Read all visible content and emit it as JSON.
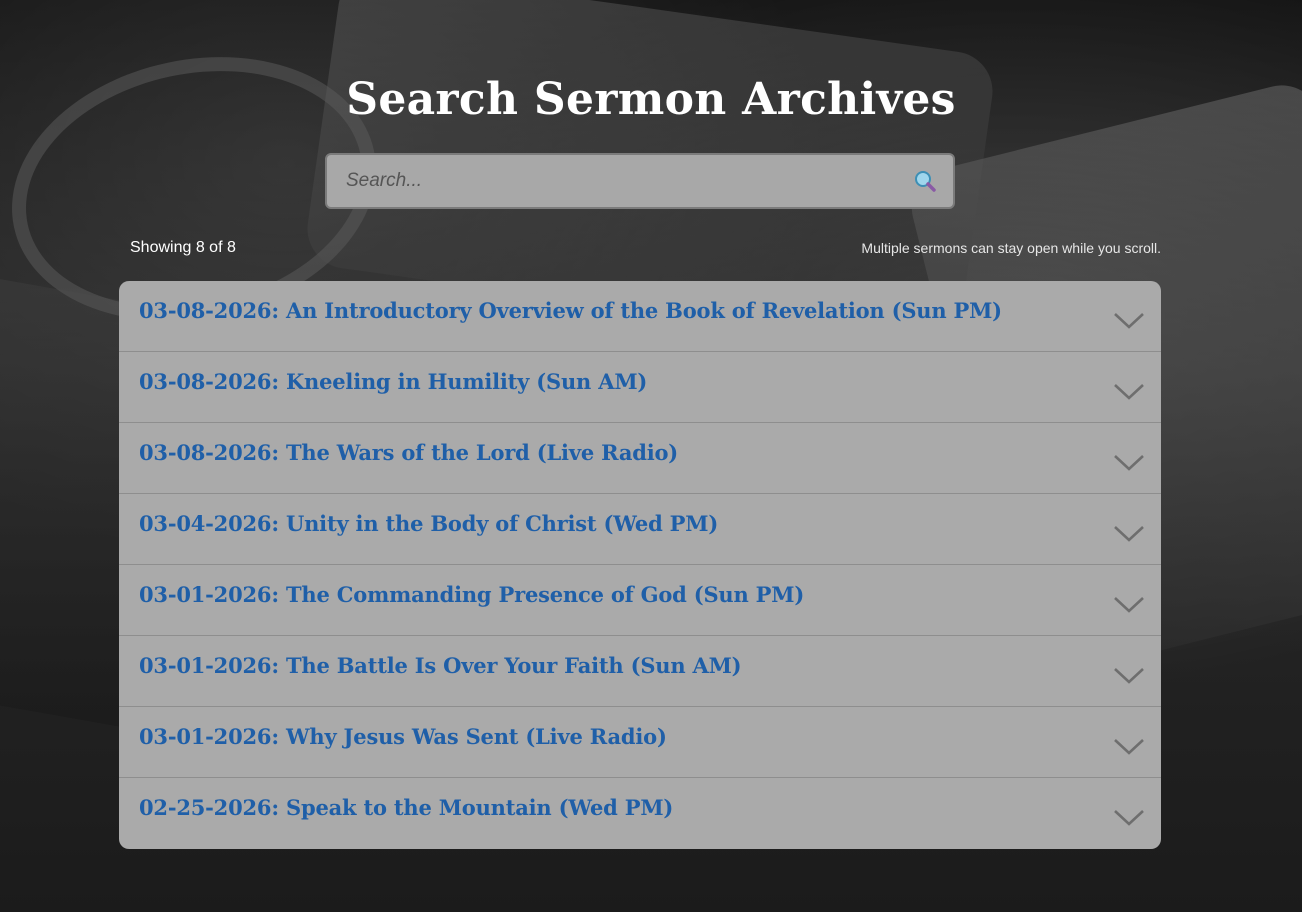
{
  "page": {
    "title": "Search Sermon Archives"
  },
  "search": {
    "placeholder": "Search...",
    "value": "",
    "icon": "magnifier-icon"
  },
  "status": {
    "count_text": "Showing 8 of 8",
    "hint_text": "Multiple sermons can stay open while you scroll."
  },
  "colors": {
    "sermon_title": "#1f5fa8",
    "list_bg": "#aaaaaa",
    "heading": "#ffffff"
  },
  "sermons": [
    {
      "title": "03-08-2026: An Introductory Overview of the Book of Revelation (Sun PM)",
      "icon": "chevron-down-icon"
    },
    {
      "title": "03-08-2026: Kneeling in Humility (Sun AM)",
      "icon": "chevron-down-icon"
    },
    {
      "title": "03-08-2026: The Wars of the Lord (Live Radio)",
      "icon": "chevron-down-icon"
    },
    {
      "title": "03-04-2026: Unity in the Body of Christ (Wed PM)",
      "icon": "chevron-down-icon"
    },
    {
      "title": "03-01-2026: The Commanding Presence of God (Sun PM)",
      "icon": "chevron-down-icon"
    },
    {
      "title": "03-01-2026: The Battle Is Over Your Faith (Sun AM)",
      "icon": "chevron-down-icon"
    },
    {
      "title": "03-01-2026: Why Jesus Was Sent (Live Radio)",
      "icon": "chevron-down-icon"
    },
    {
      "title": "02-25-2026: Speak to the Mountain (Wed PM)",
      "icon": "chevron-down-icon"
    }
  ]
}
